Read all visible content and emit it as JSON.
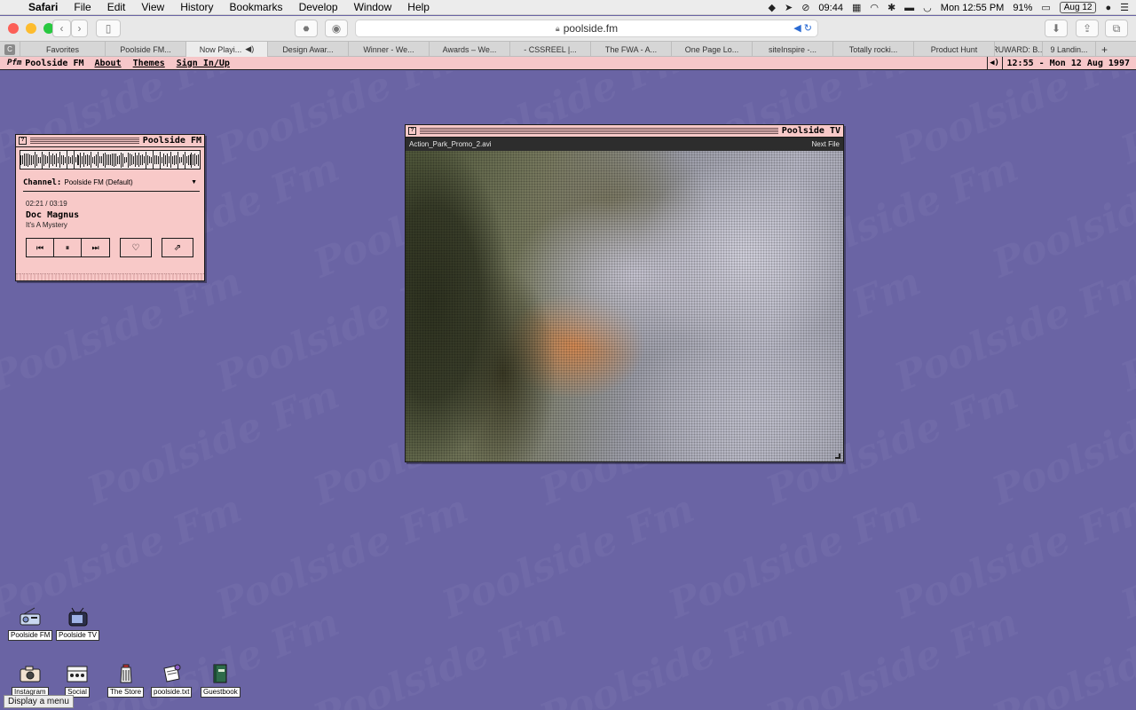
{
  "mac_menu": {
    "apple": "",
    "app": "Safari",
    "items": [
      "File",
      "Edit",
      "View",
      "History",
      "Bookmarks",
      "Develop",
      "Window",
      "Help"
    ],
    "status": {
      "time_small": "09:44",
      "clock": "Mon 12:55 PM",
      "battery": "91%",
      "date_pill": "Aug 12"
    }
  },
  "browser": {
    "url": "poolside.fm",
    "tabs": [
      "Favorites",
      "Poolside FM...",
      "Now Playi...",
      "Design Awar...",
      "Winner - We...",
      "Awards – We...",
      "- CSSREEL |...",
      "The FWA - A...",
      "One Page Lo...",
      "siteInspire -...",
      "Totally rocki...",
      "Product Hunt",
      "RUWARD: B...",
      "9 Landin..."
    ],
    "first_tab_badge": "C",
    "new_tab": "+"
  },
  "site": {
    "brand": "Poolside FM",
    "brand_mark": "Pfm",
    "links": [
      "About",
      "Themes",
      "Sign In/Up"
    ],
    "clock": "12:55 - Mon 12 Aug 1997"
  },
  "radio": {
    "title": "Poolside FM",
    "channel_label": "Channel:",
    "channel_value": "Poolside FM (Default)",
    "time": "02:21 / 03:19",
    "artist": "Doc Magnus",
    "track": "It's A Mystery"
  },
  "tv": {
    "title": "Poolside TV",
    "file": "Action_Park_Promo_2.avi",
    "next": "Next File"
  },
  "desktop_icons": [
    {
      "label": "Poolside FM",
      "icon": "radio-app-icon"
    },
    {
      "label": "Poolside TV",
      "icon": "tv-app-icon"
    },
    {
      "label": "Instagram",
      "icon": "camera-icon"
    },
    {
      "label": "Social",
      "icon": "social-icon"
    },
    {
      "label": "The Store",
      "icon": "store-icon"
    },
    {
      "label": "poolside.txt",
      "icon": "text-file-icon"
    },
    {
      "label": "Guestbook",
      "icon": "book-icon"
    }
  ],
  "watermark": "Poolside Fm",
  "tooltip": "Display a menu",
  "colors": {
    "desktop": "#6a64a4",
    "window": "#f8c9c8",
    "menubar_pink": "#f6c7c9"
  }
}
